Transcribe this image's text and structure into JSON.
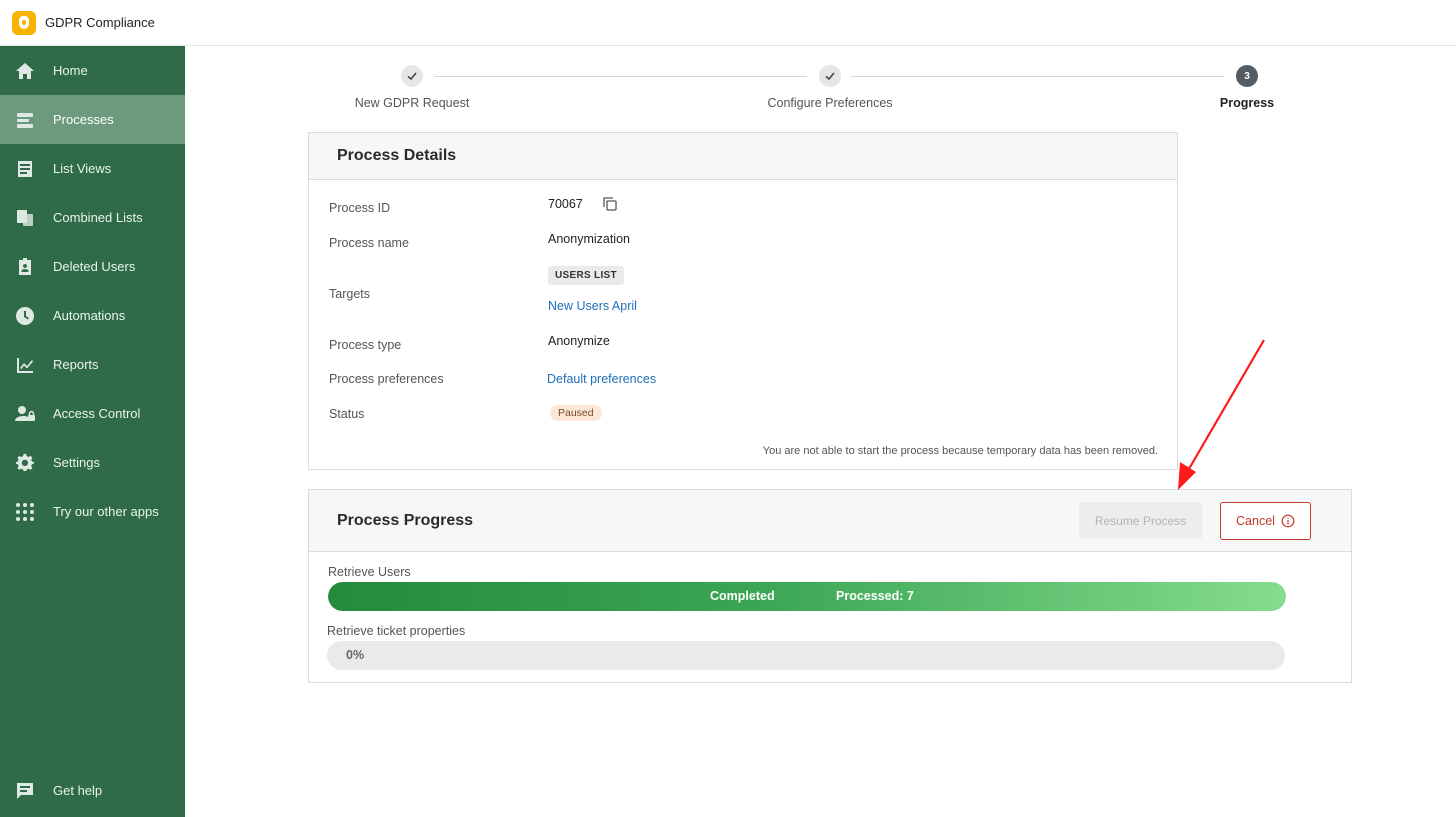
{
  "app": {
    "title": "GDPR Compliance"
  },
  "sidebar": {
    "items": [
      {
        "label": "Home",
        "icon": "home-icon"
      },
      {
        "label": "Processes",
        "icon": "processes-icon",
        "active": true
      },
      {
        "label": "List Views",
        "icon": "list-views-icon"
      },
      {
        "label": "Combined Lists",
        "icon": "combined-lists-icon"
      },
      {
        "label": "Deleted Users",
        "icon": "deleted-users-icon"
      },
      {
        "label": "Automations",
        "icon": "clock-icon"
      },
      {
        "label": "Reports",
        "icon": "chart-icon"
      },
      {
        "label": "Access Control",
        "icon": "user-lock-icon"
      },
      {
        "label": "Settings",
        "icon": "gear-icon"
      },
      {
        "label": "Try our other apps",
        "icon": "grid-icon"
      }
    ],
    "help": {
      "label": "Get help",
      "icon": "chat-icon"
    }
  },
  "stepper": {
    "steps": [
      {
        "label": "New GDPR Request",
        "state": "done"
      },
      {
        "label": "Configure Preferences",
        "state": "done"
      },
      {
        "label": "Progress",
        "state": "current",
        "number": "3"
      }
    ]
  },
  "details": {
    "title": "Process Details",
    "rows": {
      "process_id": {
        "label": "Process ID",
        "value": "70067"
      },
      "process_name": {
        "label": "Process name",
        "value": "Anonymization"
      },
      "targets": {
        "label": "Targets",
        "tag": "USERS LIST",
        "value": "New Users April"
      },
      "process_type": {
        "label": "Process type",
        "value": "Anonymize"
      },
      "preferences": {
        "label": "Process preferences",
        "value": "Default preferences"
      },
      "status": {
        "label": "Status",
        "value": "Paused"
      }
    },
    "note": "You are not able to start the process because temporary data has been removed."
  },
  "progress": {
    "title": "Process Progress",
    "resume_label": "Resume Process",
    "cancel_label": "Cancel",
    "tasks": [
      {
        "label": "Retrieve Users",
        "status": "Completed",
        "processed": "Processed: 7",
        "fraction": 1.0
      },
      {
        "label": "Retrieve ticket properties",
        "percent_text": "0%",
        "fraction": 0.0
      }
    ]
  },
  "colors": {
    "sidebar": "#2f6b47",
    "sidebar_active": "#6d9a7d",
    "link": "#1f6fb8",
    "cancel": "#c0392b",
    "progress_green": "#3aa654",
    "annotation_arrow": "#ff1a1a"
  }
}
